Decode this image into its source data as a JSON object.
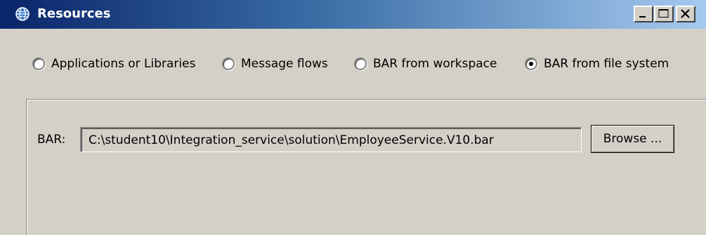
{
  "window": {
    "title": "Resources",
    "icon": "globe-icon",
    "controls": [
      "minimize-icon",
      "maximize-icon",
      "close-icon"
    ]
  },
  "source_options": [
    {
      "label": "Applications or Libraries",
      "selected": false
    },
    {
      "label": "Message flows",
      "selected": false
    },
    {
      "label": "BAR from workspace",
      "selected": false
    },
    {
      "label": "BAR from file system",
      "selected": true
    }
  ],
  "bar_field": {
    "label": "BAR:",
    "value": "C:\\student10\\Integration_service\\solution\\EmployeeService.V10.bar",
    "browse_label": "Browse ..."
  },
  "colors": {
    "window_bg": "#d4d0c8",
    "title_start": "#0a246a",
    "title_end": "#a6caf0",
    "title_text": "#ffffff"
  }
}
